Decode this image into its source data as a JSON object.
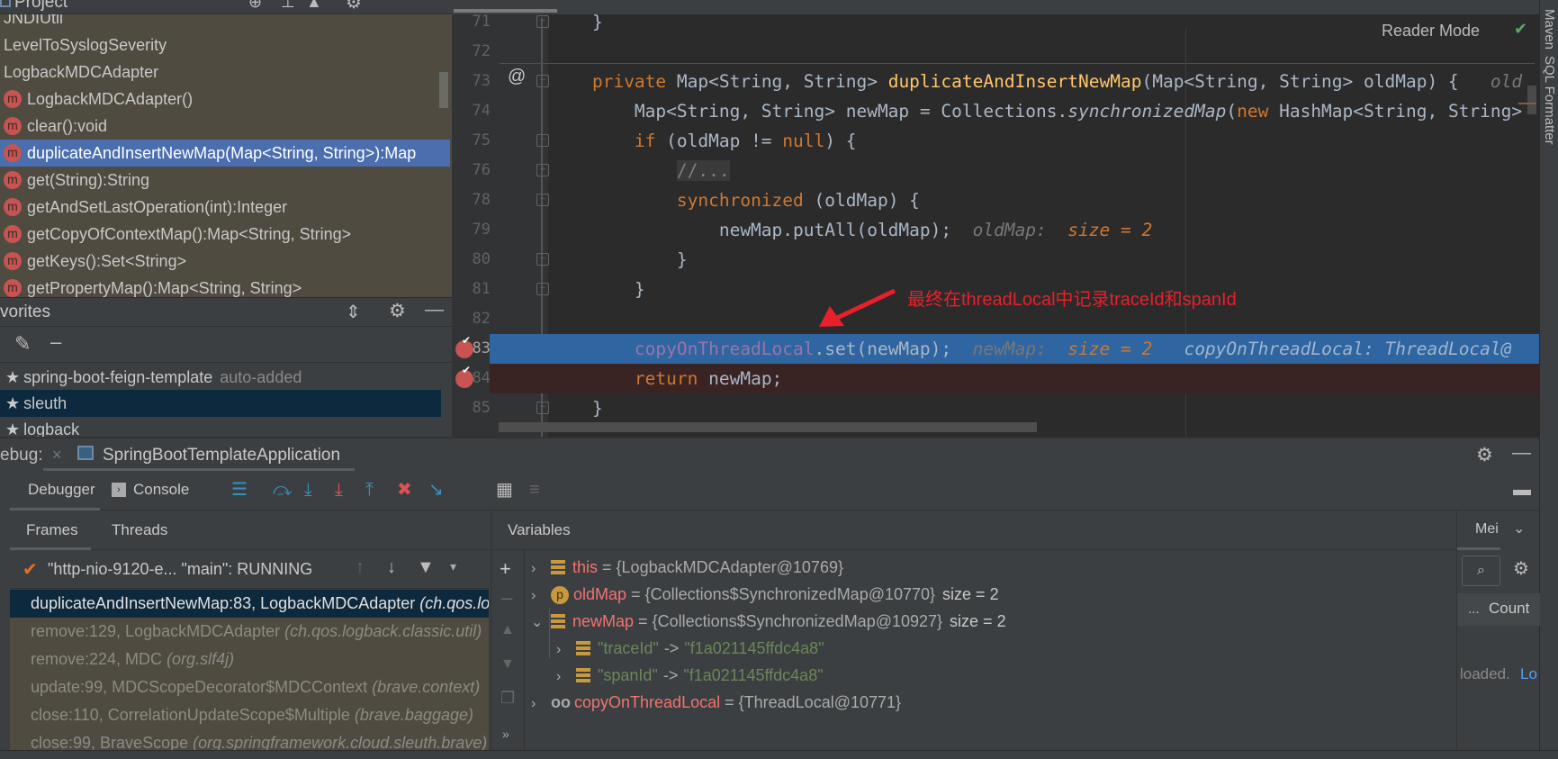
{
  "project": {
    "header": "Project",
    "items": [
      {
        "label": "JNDIUtil",
        "icon": "none"
      },
      {
        "label": "LevelToSyslogSeverity",
        "icon": "none"
      },
      {
        "label": "LogbackMDCAdapter",
        "icon": "none"
      },
      {
        "label": "LogbackMDCAdapter()",
        "icon": "method-icon"
      },
      {
        "label": "clear():void",
        "icon": "method-icon"
      },
      {
        "label": "duplicateAndInsertNewMap(Map<String, String>):Map",
        "icon": "method-icon",
        "selected": true
      },
      {
        "label": "get(String):String",
        "icon": "method-icon"
      },
      {
        "label": "getAndSetLastOperation(int):Integer",
        "icon": "method-icon"
      },
      {
        "label": "getCopyOfContextMap():Map<String, String>",
        "icon": "method-icon"
      },
      {
        "label": "getKeys():Set<String>",
        "icon": "method-icon"
      },
      {
        "label": "getPropertyMap():Map<String, String>",
        "icon": "method-icon"
      }
    ],
    "method_glyph": "m"
  },
  "favorites": {
    "title": "vorites",
    "items": [
      {
        "label": "spring-boot-feign-template",
        "suffix": "auto-added"
      },
      {
        "label": "sleuth",
        "selected": true
      },
      {
        "label": "logback"
      }
    ]
  },
  "editor": {
    "reader_mode": "Reader Mode",
    "lines": [
      {
        "n": "71",
        "html": "    }"
      },
      {
        "n": "72",
        "html": ""
      },
      {
        "n": "73",
        "html": "    <span class=kw>private</span> Map&lt;String, String&gt; <span class=fn>duplicateAndInsertNewMap</span>(Map&lt;String, String&gt; oldMap) {   <span class=hint>old</span>"
      },
      {
        "n": "74",
        "html": "        Map&lt;String, String&gt; newMap = Collections.<span class=it>synchronizedMap</span>(<span class=kw>new</span> HashMap&lt;String, String&gt;"
      },
      {
        "n": "75",
        "html": "        <span class=kw>if</span> (oldMap != <span class=kw>null</span>) {"
      },
      {
        "n": "76",
        "html": "            <span class=cm style='background:#3a3a3a'>//...</span>"
      },
      {
        "n": "78",
        "html": "            <span class=kw>synchronized</span> (oldMap) {"
      },
      {
        "n": "79",
        "html": "                newMap.putAll(oldMap);  <span class=hint>oldMap:</span>  <span class=hv>size = 2</span>"
      },
      {
        "n": "80",
        "html": "            }"
      },
      {
        "n": "81",
        "html": "        }"
      },
      {
        "n": "82",
        "html": ""
      },
      {
        "n": "83",
        "html": "        <span class=fld>copyOnThreadLocal</span>.set(newMap);  <span class=hint>newMap:</span>  <span class=hv>size = 2</span>   <span class=hint style='color:#9fb6cf'>copyOnThreadLocal: ThreadLocal@</span>",
        "current": true
      },
      {
        "n": "84",
        "html": "        <span class=kw>return</span> newMap;",
        "breakpoint": true
      },
      {
        "n": "85",
        "html": "    }"
      }
    ],
    "annotation": "最终在threadLocal中记录traceId和spanId"
  },
  "right_strip": [
    "Maven",
    "SQL Formatter"
  ],
  "debug": {
    "label": "ebug:",
    "config": "SpringBootTemplateApplication",
    "tabs": [
      "Debugger",
      "Console"
    ],
    "frames_tabs": [
      "Frames",
      "Threads"
    ],
    "thread": "\"http-nio-9120-e... \"main\": RUNNING",
    "frames": [
      {
        "m": "duplicateAndInsertNewMap:83, LogbackMDCAdapter ",
        "p": "(ch.qos.logback.classic.util)",
        "selected": true
      },
      {
        "m": "remove:129, LogbackMDCAdapter ",
        "p": "(ch.qos.logback.classic.util)"
      },
      {
        "m": "remove:224, MDC ",
        "p": "(org.slf4j)"
      },
      {
        "m": "update:99, MDCScopeDecorator$MDCContext ",
        "p": "(brave.context)"
      },
      {
        "m": "close:110, CorrelationUpdateScope$Multiple ",
        "p": "(brave.baggage)"
      },
      {
        "m": "close:99, BraveScope ",
        "p": "(org.springframework.cloud.sleuth.brave)"
      }
    ],
    "variables_title": "Variables",
    "variables": [
      {
        "name": "this",
        "val": "{LogbackMDCAdapter@10769}",
        "extra": "",
        "icon": "field-icon",
        "expanded": false
      },
      {
        "name": "oldMap",
        "val": "{Collections$SynchronizedMap@10770}",
        "extra": "size = 2",
        "icon": "parameter-icon",
        "expanded": false
      },
      {
        "name": "newMap",
        "val": "{Collections$SynchronizedMap@10927}",
        "extra": "size = 2",
        "icon": "field-icon",
        "expanded": true
      },
      {
        "key": "\"traceId\"",
        "val": "\"f1a021145ffdc4a8\"",
        "child": true
      },
      {
        "key": "\"spanId\"",
        "val": "\"f1a021145ffdc4a8\"",
        "child": true
      },
      {
        "name": "copyOnThreadLocal",
        "val": "{ThreadLocal@10771}",
        "extra": "",
        "icon": "watch-icon",
        "expanded": false
      }
    ],
    "memory": {
      "tab": "Mei",
      "col_dots": "...",
      "col_count": "Count",
      "status": "loaded.",
      "link": "Lo"
    },
    "arrow": "->"
  },
  "colors": {
    "annotation": "#e8202a",
    "selection": "#4b6eaf",
    "current_line": "#2f65a0",
    "breakpoint_line": "#3a2323"
  }
}
